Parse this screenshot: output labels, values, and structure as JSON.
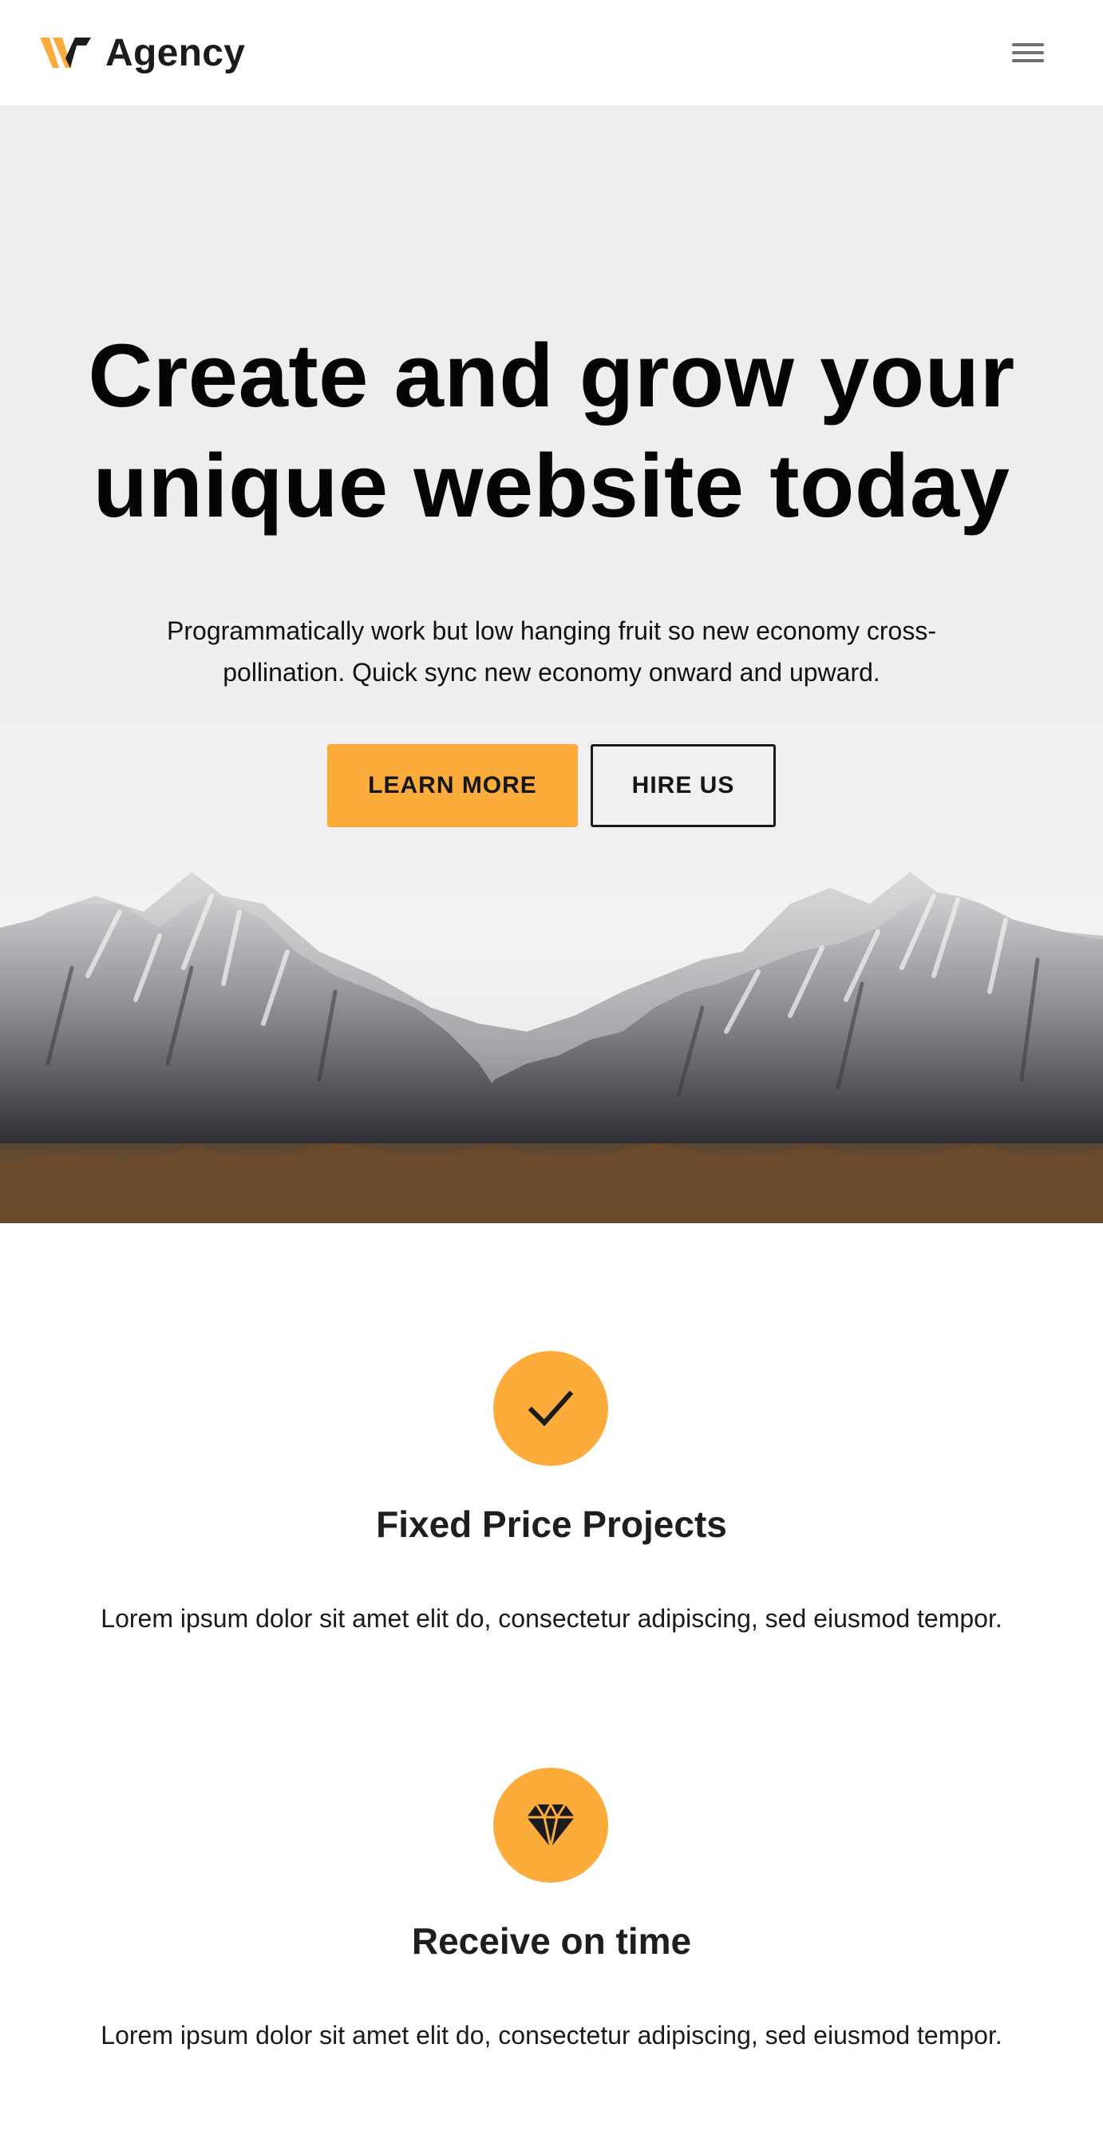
{
  "header": {
    "brand": "Agency",
    "logo_icon": "w-logo-icon",
    "menu_icon": "hamburger-menu-icon"
  },
  "hero": {
    "title": "Create and grow your unique website today",
    "subtitle": "Programmatically work but low hanging fruit so new economy cross-pollination. Quick sync new economy onward and upward.",
    "primary_button": "LEARN MORE",
    "secondary_button": "HIRE US",
    "background_image": "snowy-mountains-image"
  },
  "features": [
    {
      "icon": "checkmark-icon",
      "title": "Fixed Price Projects",
      "text": "Lorem ipsum dolor sit amet elit do, consectetur adipiscing, sed eiusmod tempor."
    },
    {
      "icon": "diamond-icon",
      "title": "Receive on time",
      "text": "Lorem ipsum dolor sit amet elit do, consectetur adipiscing, sed eiusmod tempor."
    }
  ],
  "colors": {
    "accent": "#fbac3b",
    "text": "#111111",
    "background": "#ffffff",
    "hero_background": "#ececec"
  }
}
